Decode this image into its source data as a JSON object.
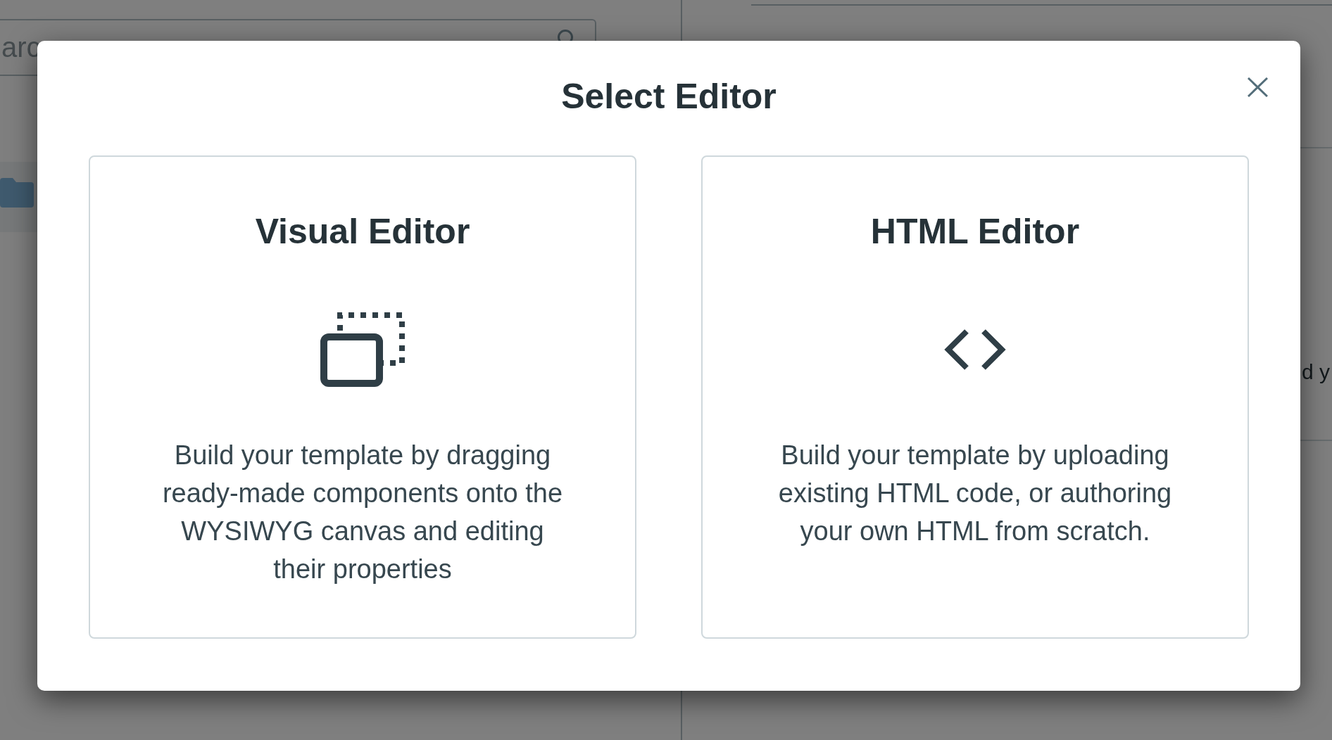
{
  "background_page": {
    "search_field": {
      "placeholder": "arc"
    },
    "partial_text": "d y"
  },
  "dialog": {
    "title": "Select Editor",
    "options": [
      {
        "kind": "visual",
        "title": "Visual Editor",
        "description": "Build your template by dragging ready-made components onto the WYSIWYG canvas and editing their properties"
      },
      {
        "kind": "html",
        "title": "HTML Editor",
        "description": "Build your template by uploading existing HTML code, or authoring your own HTML from scratch."
      }
    ]
  }
}
